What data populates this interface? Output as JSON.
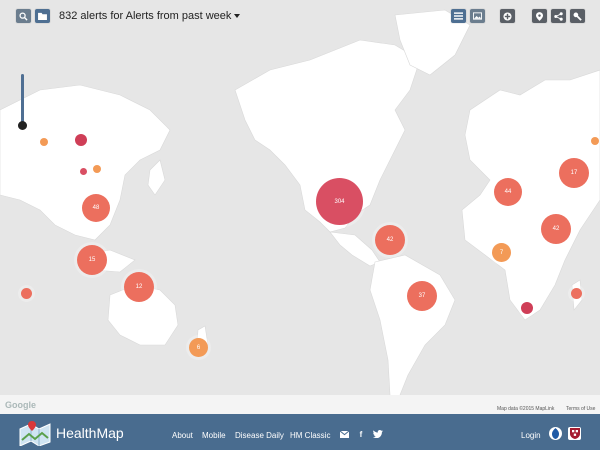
{
  "toolbar": {
    "alerts_title": "832 alerts for Alerts from past week",
    "buttons": [
      {
        "name": "search-button",
        "icon": "search-icon"
      },
      {
        "name": "folder-button",
        "icon": "folder-icon"
      },
      {
        "name": "list-view-button",
        "icon": "list-icon"
      },
      {
        "name": "image-view-button",
        "icon": "image-icon"
      },
      {
        "name": "add-button",
        "icon": "plus-icon"
      },
      {
        "name": "location-button",
        "icon": "location-icon"
      },
      {
        "name": "share-button",
        "icon": "share-icon"
      },
      {
        "name": "settings-button",
        "icon": "wrench-icon"
      }
    ]
  },
  "markers": [
    {
      "name": "marker-north-america",
      "count": "304",
      "color": "#d94f63"
    },
    {
      "name": "marker-europe-west",
      "count": "44",
      "color": "#ec6f5e"
    },
    {
      "name": "marker-east-asia",
      "count": "48",
      "color": "#ec6f5e"
    },
    {
      "name": "marker-southeast-asia",
      "count": "15",
      "color": "#ec6f5e"
    },
    {
      "name": "marker-caribbean",
      "count": "42",
      "color": "#ec6f5e"
    },
    {
      "name": "marker-middle-east",
      "count": "42",
      "color": "#ec6f5e"
    },
    {
      "name": "marker-europe-east",
      "count": "17",
      "color": "#ec6f5e"
    },
    {
      "name": "marker-australia",
      "count": "12",
      "color": "#ec6f5e"
    },
    {
      "name": "marker-brazil",
      "count": "37",
      "color": "#ec6f5e"
    },
    {
      "name": "marker-west-africa",
      "count": "7",
      "color": "#f39a56"
    },
    {
      "name": "marker-new-zealand",
      "count": "6",
      "color": "#f39a56"
    }
  ],
  "map": {
    "attribution": "Map data ©2015 MapLink",
    "terms": "Terms of Use",
    "provider": "Google"
  },
  "footer": {
    "brand": "HealthMap",
    "links": [
      "About",
      "Mobile",
      "Disease Daily",
      "HM Classic"
    ],
    "login": "Login"
  }
}
